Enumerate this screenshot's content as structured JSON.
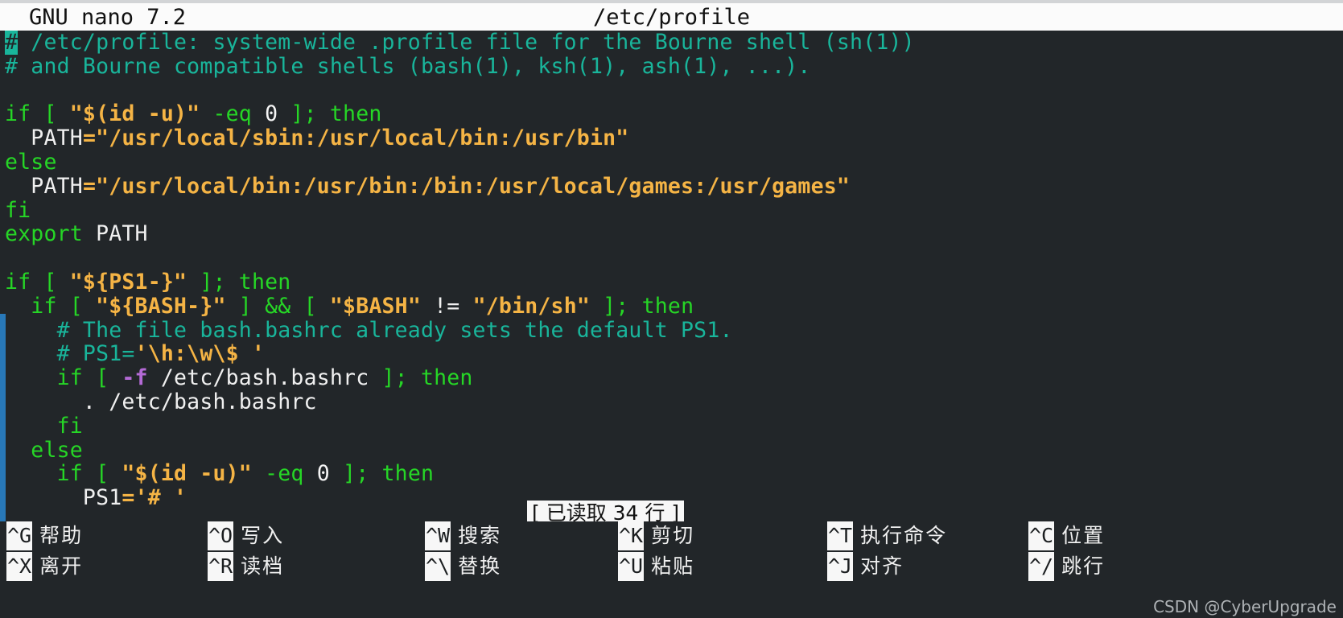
{
  "titlebar": {
    "version": "GNU nano 7.2",
    "filename": "/etc/profile"
  },
  "editor": {
    "lines": [
      "# /etc/profile: system-wide .profile file for the Bourne shell (sh(1))",
      "# and Bourne compatible shells (bash(1), ksh(1), ash(1), ...).",
      "",
      "if [ \"$(id -u)\" -eq 0 ]; then",
      "  PATH=\"/usr/local/sbin:/usr/local/bin:/usr/bin\"",
      "else",
      "  PATH=\"/usr/local/bin:/usr/bin:/bin:/usr/local/games:/usr/games\"",
      "fi",
      "export PATH",
      "",
      "if [ \"${PS1-}\" ]; then",
      "  if [ \"${BASH-}\" ] && [ \"$BASH\" != \"/bin/sh\" ]; then",
      "    # The file bash.bashrc already sets the default PS1.",
      "    # PS1='\\h:\\w\\$ '",
      "    if [ -f /etc/bash.bashrc ]; then",
      "      . /etc/bash.bashrc",
      "    fi",
      "  else",
      "    if [ \"$(id -u)\" -eq 0 ]; then",
      "      PS1='# '"
    ],
    "tokens": [
      [
        [
          "# /etc/profile: system-wide .profile file for the Bourne shell (sh(1))",
          "cmt-cursor"
        ]
      ],
      [
        [
          "# and Bourne compatible shells (bash(1), ksh(1), ash(1), ...).",
          "cmt"
        ]
      ],
      [],
      [
        [
          "if ",
          "kw"
        ],
        [
          "[ ",
          "brk"
        ],
        [
          "\"$(id -u)\"",
          "str"
        ],
        [
          " -eq ",
          "op"
        ],
        [
          "0",
          "num"
        ],
        [
          " ]; ",
          "brk"
        ],
        [
          "then",
          "kw"
        ]
      ],
      [
        [
          "  PATH",
          "plain"
        ],
        [
          "=",
          "str"
        ],
        [
          "\"/usr/local/sbin:/usr/local/bin:/usr/bin\"",
          "str"
        ]
      ],
      [
        [
          "else",
          "kw"
        ]
      ],
      [
        [
          "  PATH",
          "plain"
        ],
        [
          "=",
          "str"
        ],
        [
          "\"/usr/local/bin:/usr/bin:/bin:/usr/local/games:/usr/games\"",
          "str"
        ]
      ],
      [
        [
          "fi",
          "kw"
        ]
      ],
      [
        [
          "export ",
          "kw"
        ],
        [
          "PATH",
          "plain"
        ]
      ],
      [],
      [
        [
          "if ",
          "kw"
        ],
        [
          "[ ",
          "brk"
        ],
        [
          "\"${PS1-}\"",
          "str"
        ],
        [
          " ]; ",
          "brk"
        ],
        [
          "then",
          "kw"
        ]
      ],
      [
        [
          "  if ",
          "kw"
        ],
        [
          "[ ",
          "brk"
        ],
        [
          "\"${BASH-}\"",
          "str"
        ],
        [
          " ] ",
          "brk"
        ],
        [
          "&& ",
          "op"
        ],
        [
          "[ ",
          "brk"
        ],
        [
          "\"$BASH\"",
          "str"
        ],
        [
          " != ",
          "plain"
        ],
        [
          "\"/bin/sh\"",
          "str"
        ],
        [
          " ]; ",
          "brk"
        ],
        [
          "then",
          "kw"
        ]
      ],
      [
        [
          "    # The file bash.bashrc already sets the default PS1.",
          "cmt"
        ]
      ],
      [
        [
          "    # PS1=",
          "cmt"
        ],
        [
          "'\\h:\\w\\$ '",
          "str"
        ]
      ],
      [
        [
          "    if ",
          "kw"
        ],
        [
          "[ ",
          "brk"
        ],
        [
          "-f",
          "flag"
        ],
        [
          " /etc/bash.bashrc ",
          "plain"
        ],
        [
          "]; ",
          "brk"
        ],
        [
          "then",
          "kw"
        ]
      ],
      [
        [
          "      . /etc/bash.bashrc",
          "plain"
        ]
      ],
      [
        [
          "    fi",
          "kw"
        ]
      ],
      [
        [
          "  else",
          "kw"
        ]
      ],
      [
        [
          "    if ",
          "kw"
        ],
        [
          "[ ",
          "brk"
        ],
        [
          "\"$(id -u)\"",
          "str"
        ],
        [
          " -eq ",
          "op"
        ],
        [
          "0",
          "num"
        ],
        [
          " ]; ",
          "brk"
        ],
        [
          "then",
          "kw"
        ]
      ],
      [
        [
          "      PS1",
          "plain"
        ],
        [
          "=",
          "str"
        ],
        [
          "'# '",
          "str"
        ]
      ]
    ]
  },
  "status": {
    "message": "[ 已读取 34 行 ]"
  },
  "shortcuts": [
    {
      "key1": "^G",
      "label1": "帮助",
      "key2": "^X",
      "label2": "离开"
    },
    {
      "key1": "^O",
      "label1": "写入",
      "key2": "^R",
      "label2": "读档"
    },
    {
      "key1": "^W",
      "label1": "搜索",
      "key2": "^\\",
      "label2": "替换"
    },
    {
      "key1": "^K",
      "label1": "剪切",
      "key2": "^U",
      "label2": "粘贴"
    },
    {
      "key1": "^T",
      "label1": "执行命令",
      "key2": "^J",
      "label2": "对齐"
    },
    {
      "key1": "^C",
      "label1": "位置",
      "key2": "^/",
      "label2": "跳行"
    }
  ],
  "watermark": {
    "text": "CSDN @CyberUpgrade"
  },
  "colors": {
    "background": "#222629",
    "titlebar_bg": "#fbfbfb",
    "comment": "#19b59b",
    "keyword": "#26d626",
    "string": "#f5b445",
    "flag": "#b46ad6",
    "scrollbar": "#2878b8",
    "cursor": "#19b59b"
  }
}
